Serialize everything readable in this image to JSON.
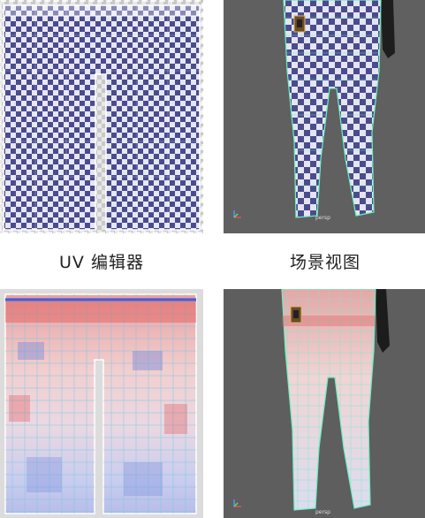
{
  "captions": {
    "uv_editor": "UV 编辑器",
    "scene_view": "场景视图"
  },
  "viewport": {
    "camera_label_top": "persp",
    "camera_label_bottom": "persp"
  },
  "colors": {
    "checker_dark": "#4a4c8c",
    "checker_light": "#e6e6f5",
    "wire": "#6cf0c0",
    "heat_red": "#e05a5a",
    "heat_blue": "#6f86d8",
    "viewport_bg": "#606060"
  },
  "icons": {
    "axis": "axis-gizmo-icon",
    "badge": "patch-badge-icon"
  }
}
